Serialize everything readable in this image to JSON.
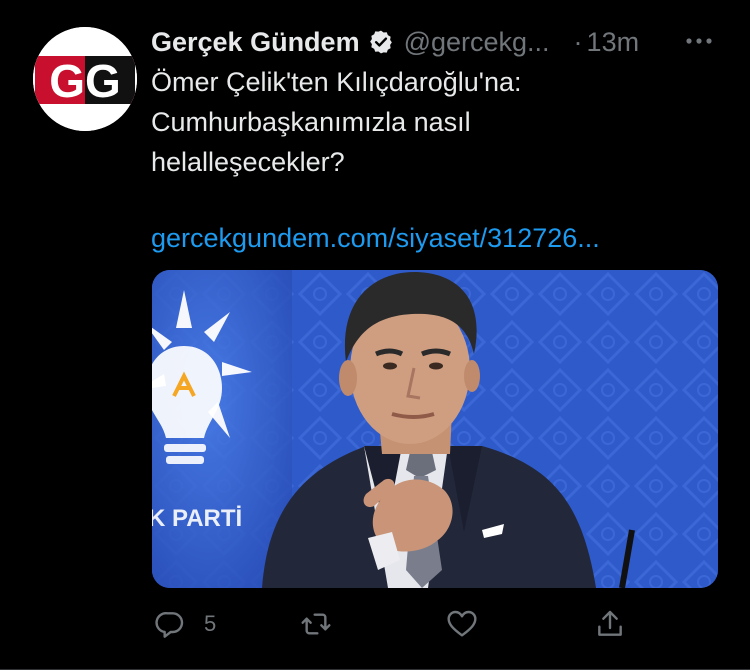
{
  "author": {
    "name": "Gerçek Gündem",
    "handle": "@gercekg...",
    "time": "13m",
    "separator": "·",
    "avatar_text": "GG",
    "verified": true
  },
  "tweet": {
    "lines": [
      "Ömer Çelik'ten Kılıçdaroğlu'na:",
      "Cumhurbaşkanımızla nasıl",
      "helalleşecekler?"
    ],
    "link": "gercekgundem.com/siyaset/312726..."
  },
  "media": {
    "backdrop_text": "K PARTİ"
  },
  "actions": {
    "reply_count": "5",
    "retweet_count": "",
    "like_count": ""
  },
  "icons": {
    "verified": "verified-badge-icon",
    "more": "more-options-icon",
    "reply": "reply-icon",
    "retweet": "retweet-icon",
    "like": "heart-icon",
    "share": "share-icon"
  },
  "colors": {
    "background": "#000000",
    "text": "#e7e9ea",
    "secondary": "#71767b",
    "link": "#1d9bf0",
    "media_bg": "#2f5ac9",
    "avatar_red": "#c8102e"
  }
}
